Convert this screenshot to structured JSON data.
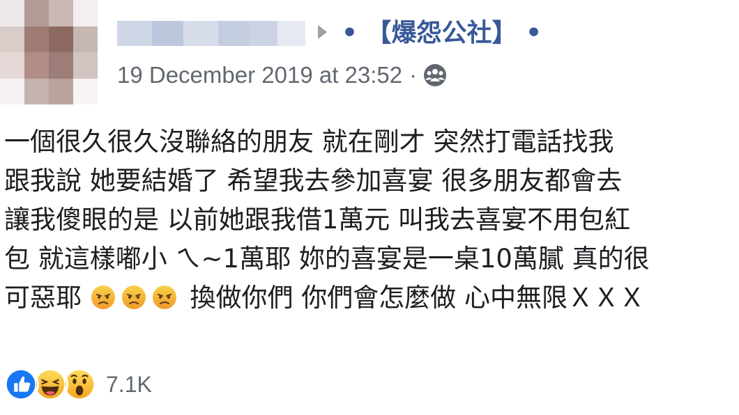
{
  "post": {
    "author_name_blurred": "",
    "group_name": "• 【爆怨公社】 •",
    "timestamp": "19 December 2019 at 23:52",
    "separator": "·",
    "privacy_icon": "group-icon",
    "text_lines": [
      "一個很久很久沒聯絡的朋友 就在剛才 突然打電話找我",
      "跟我說 她要結婚了 希望我去參加喜宴 很多朋友都會去",
      "讓我傻眼的是 以前她跟我借1萬元 叫我去喜宴不用包紅",
      "包 就這樣嘟小 ㄟ~1萬耶 妳的喜宴是一桌10萬膩 真的很",
      "換做你們 你們會怎麼做 心中無限ＸＸＸ"
    ],
    "last_line_prefix": "可惡耶",
    "last_line_emojis": [
      "angry-face-icon",
      "angry-face-icon",
      "angry-face-icon"
    ],
    "reactions": {
      "icons": [
        "like-icon",
        "haha-icon",
        "wow-icon"
      ],
      "count": "7.1K"
    }
  },
  "colors": {
    "link_blue": "#385898",
    "meta_gray": "#616770",
    "text": "#1c1e21",
    "like_blue": "#1877f2",
    "emoji_yellow": "#f7b125"
  }
}
